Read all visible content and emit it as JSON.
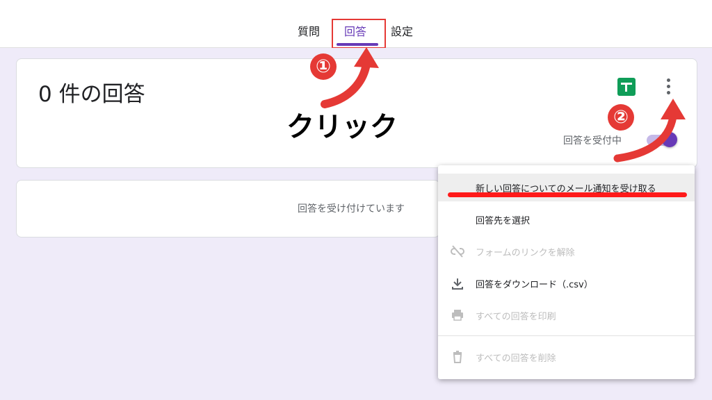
{
  "tabs": [
    {
      "label": "質問"
    },
    {
      "label": "回答",
      "active": true
    },
    {
      "label": "設定"
    }
  ],
  "summary": {
    "response_count": "0 件の回答",
    "accepting_label": "回答を受付中",
    "accepting_on": true
  },
  "responses_card": {
    "message": "回答を受け付けています"
  },
  "annotations": {
    "step1": "①",
    "step2": "②",
    "click_label": "クリック"
  },
  "menu": {
    "items": [
      {
        "label": "新しい回答についてのメール通知を受け取る",
        "icon": "none",
        "enabled": true
      },
      {
        "label": "回答先を選択",
        "icon": "none",
        "enabled": true
      },
      {
        "label": "フォームのリンクを解除",
        "icon": "link-off-icon",
        "enabled": false
      },
      {
        "label": "回答をダウンロード（.csv）",
        "icon": "download-icon",
        "enabled": true
      },
      {
        "label": "すべての回答を印刷",
        "icon": "print-icon",
        "enabled": false
      },
      {
        "label": "すべての回答を削除",
        "icon": "trash-icon",
        "enabled": false
      }
    ]
  },
  "colors": {
    "accent": "#673ab7",
    "annotation_red": "#e53935",
    "sheets_green": "#0f9d58",
    "background": "#efebf9"
  }
}
